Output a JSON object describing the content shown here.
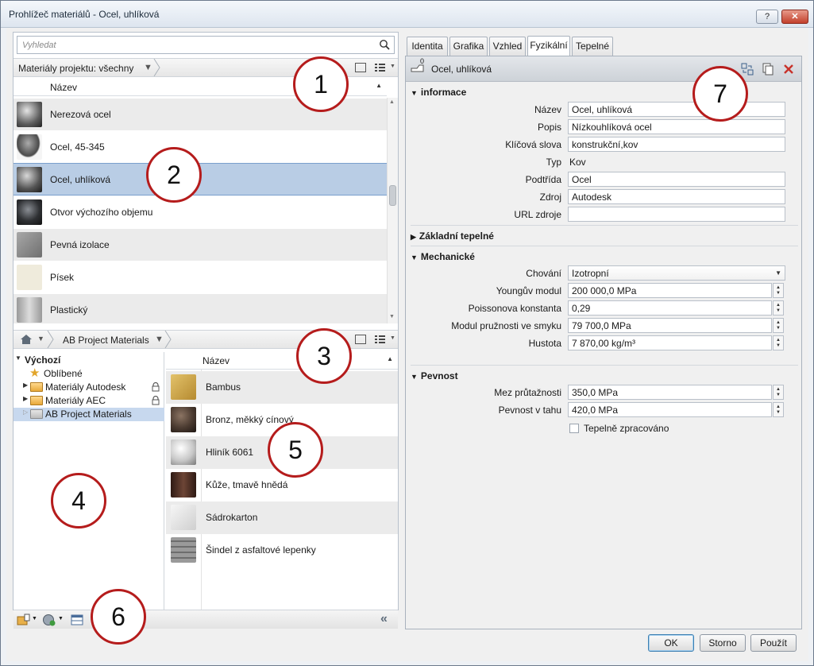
{
  "window": {
    "title": "Prohlížeč materiálů - Ocel, uhlíková",
    "help_label": "?",
    "close_label": "✕"
  },
  "search": {
    "placeholder": "Vyhledat"
  },
  "project": {
    "breadcrumb": "Materiály projektu: všechny",
    "column_header": "Název",
    "materials": [
      {
        "label": "Nerezová ocel",
        "swatch": "#5d5d5d"
      },
      {
        "label": "Ocel, 45-345",
        "swatch": "#4a4a4a"
      },
      {
        "label": "Ocel, uhlíková",
        "swatch": "#555555",
        "selected": true
      },
      {
        "label": "Otvor výchozího objemu",
        "swatch": "#2e3033"
      },
      {
        "label": "Pevná izolace",
        "swatch": "#8e8e8e"
      },
      {
        "label": "Písek",
        "swatch": "#efebdc"
      },
      {
        "label": "Plastický",
        "swatch": "#b4b4b4"
      }
    ]
  },
  "library": {
    "breadcrumb": "AB Project Materials",
    "column_header": "Název",
    "tree": [
      {
        "label": "Výchozí",
        "type": "root"
      },
      {
        "label": "Oblíbené",
        "type": "favorites"
      },
      {
        "label": "Materiály Autodesk",
        "type": "folder",
        "locked": true
      },
      {
        "label": "Materiály AEC",
        "type": "folder",
        "locked": true
      },
      {
        "label": "AB Project Materials",
        "type": "folder",
        "selected": true
      }
    ],
    "materials": [
      {
        "label": "Bambus",
        "swatch": "#d2aa4e"
      },
      {
        "label": "Bronz, měkký cínový",
        "swatch": "#4a3a30"
      },
      {
        "label": "Hliník 6061",
        "swatch": "#c8c8c8"
      },
      {
        "label": "Kůže, tmavě hnědá",
        "swatch": "#4e3026"
      },
      {
        "label": "Sádrokarton",
        "swatch": "#e6e6e6"
      },
      {
        "label": "Šindel z asfaltové lepenky",
        "swatch": "#8a8a8a"
      }
    ]
  },
  "tabs": [
    "Identita",
    "Grafika",
    "Vzhled",
    "Fyzikální",
    "Tepelné"
  ],
  "active_tab": "Fyzikální",
  "asset": {
    "name": "Ocel, uhlíková",
    "users": "0"
  },
  "info": {
    "section": "informace",
    "rows": [
      {
        "label": "Název",
        "value": "Ocel, uhlíková"
      },
      {
        "label": "Popis",
        "value": "Nízkouhlíková ocel"
      },
      {
        "label": "Klíčová slova",
        "value": "konstrukční,kov"
      },
      {
        "label": "Typ",
        "value": "Kov"
      },
      {
        "label": "Podtřída",
        "value": "Ocel"
      },
      {
        "label": "Zdroj",
        "value": "Autodesk"
      },
      {
        "label": "URL zdroje",
        "value": ""
      }
    ]
  },
  "thermal_section": "Základní tepelné",
  "mechanical": {
    "section": "Mechanické",
    "behavior_label": "Chování",
    "behavior_value": "Izotropní",
    "rows": [
      {
        "label": "Youngův modul",
        "value": "200 000,0 MPa"
      },
      {
        "label": "Poissonova konstanta",
        "value": "0,29"
      },
      {
        "label": "Modul pružnosti ve smyku",
        "value": "79 700,0 MPa"
      },
      {
        "label": "Hustota",
        "value": "7 870,00 kg/m³"
      }
    ]
  },
  "strength": {
    "section": "Pevnost",
    "rows": [
      {
        "label": "Mez průtažnosti",
        "value": "350,0 MPa"
      },
      {
        "label": "Pevnost v tahu",
        "value": "420,0 MPa"
      }
    ],
    "heat_treated_label": "Tepelně zpracováno",
    "heat_treated": false
  },
  "buttons": {
    "ok": "OK",
    "cancel": "Storno",
    "apply": "Použít"
  },
  "callouts": [
    "1",
    "2",
    "3",
    "4",
    "5",
    "6",
    "7"
  ],
  "colors": {
    "callout_ring": "#b51c1c",
    "selection": "#b9cde5",
    "close": "#c2402c"
  }
}
